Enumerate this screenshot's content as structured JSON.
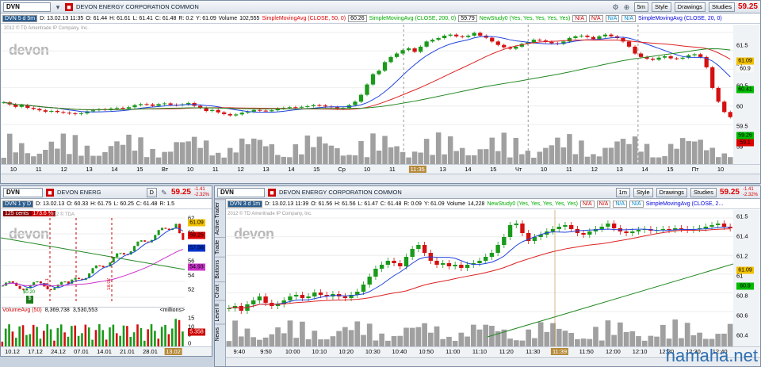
{
  "top": {
    "symbol": "DVN",
    "company": "DEVON ENERGY CORPORATION COMMON",
    "timeframe_label": "DVN 5 d 5m",
    "date": "D: 13.02.13 11:35",
    "open": "O: 61.44",
    "high": "H: 61.61",
    "low": "L: 61.41",
    "close": "C: 61.48",
    "range": "R: 0.2",
    "y": "Y: 61.09",
    "volume_label": "Volume",
    "volume": "102,555",
    "sma50": "SimpleMovingAvg (CLOSE, 50, 0)",
    "sma50_val": "60.26",
    "sma200": "SimpleMovingAvg (CLOSE, 200, 0)",
    "sma200_val": "59.79",
    "study": "NewStudy0 (Yes, Yes, Yes, Yes, Yes)",
    "na": "N/A",
    "sma20": "SimpleMovingAvg (CLOSE, 20, 0)",
    "price": "59.25",
    "aggregation": "5m",
    "style_label": "Style",
    "drawings_label": "Drawings",
    "studies_label": "Studies",
    "copyright": "2012 © TD Ameritrade IP Company, Inc.",
    "watermark": "devon",
    "x_labels": [
      "10",
      "11",
      "12",
      "13",
      "14",
      "15",
      "Вт",
      "10",
      "11",
      "12",
      "13",
      "14",
      "15",
      "Ср",
      "10",
      "11",
      "11:35",
      "13",
      "14",
      "15",
      "Чт",
      "10",
      "11",
      "12",
      "13",
      "14",
      "15",
      "Пт",
      "10"
    ],
    "y_labels": [
      "61.5",
      "61",
      "60.5",
      "60",
      "59.5",
      "59"
    ],
    "y_tags": [
      "61.09",
      "60.9",
      "60.41",
      "59.26",
      "59.1"
    ],
    "candles": [
      59.68,
      59.62,
      59.55,
      59.6,
      59.52,
      59.49,
      59.45,
      59.41,
      59.43,
      59.4,
      59.38,
      59.36,
      59.34,
      59.36,
      59.42,
      59.45,
      59.48,
      59.47,
      59.5,
      59.52,
      59.5,
      59.54,
      59.6,
      59.63,
      59.62,
      59.58,
      59.63,
      59.65,
      59.61,
      59.6,
      59.62,
      59.66,
      59.58,
      59.52,
      59.43,
      59.46,
      59.39,
      59.34,
      59.3,
      59.33,
      59.38,
      59.41,
      59.46,
      59.44,
      59.42,
      59.45,
      59.5,
      59.52,
      59.54,
      59.53,
      59.55,
      59.57,
      59.6,
      59.59,
      59.56,
      59.54,
      59.5,
      59.52,
      59.6,
      59.7,
      59.9,
      60.2,
      60.5,
      60.6,
      60.85,
      61.0,
      61.1,
      61.2,
      61.25,
      61.15,
      61.3,
      61.45,
      61.5,
      61.55,
      61.62,
      61.65,
      61.6,
      61.58,
      61.62,
      61.7,
      61.62,
      61.56,
      61.45,
      61.35,
      61.28,
      61.24,
      61.3,
      61.38,
      61.42,
      61.5,
      61.48,
      61.44,
      61.4,
      61.38,
      61.45,
      61.55,
      61.6,
      61.62,
      61.58,
      61.52,
      61.6,
      61.65,
      61.6,
      61.55,
      61.45,
      61.3,
      61.1,
      61.0,
      60.95,
      60.92,
      60.98,
      61.02,
      60.96,
      60.95,
      60.98,
      61.05,
      61.08,
      61.0,
      60.7,
      60.1,
      59.7,
      59.4,
      59.25
    ]
  },
  "left": {
    "symbol": "DVN",
    "company": "DEVON ENERG",
    "timeframe_label": "DVN 1 y D",
    "date": "D: 13.02.13",
    "open": "O: 60.33",
    "high": "H: 61.75",
    "low": "L: 60.25",
    "close": "C: 61.48",
    "range": "R: 1.5",
    "price": "59.25",
    "change": "-1.41",
    "change_pct": "-2.32%",
    "aggregation": "D",
    "badge_cents": "125 cents",
    "badge_pct": "173.6 %",
    "watermark": "devon",
    "copyright": "2012 © TDA",
    "vol_label": "VolumeAvg (50)",
    "vol1": "8,369,738",
    "vol2": "3,530,553",
    "millions": "<millions>",
    "vol_tag": "5.358",
    "y_labels": [
      "62",
      "60",
      "58",
      "56",
      "54",
      "52"
    ],
    "y_tags": [
      "61.09",
      "59.25",
      "57.56",
      "54.93"
    ],
    "vol_y": [
      "15",
      "10",
      "5",
      "0"
    ],
    "x_labels": [
      "10.12",
      "17.12",
      "24.12",
      "07.01",
      "14.01",
      "21.01",
      "28.01",
      "13.02"
    ],
    "annot1": "21.1",
    "annot2": "18.02",
    "annot3": "$0.20"
  },
  "main": {
    "symbol": "DVN",
    "company": "DEVON ENERGY CORPORATION COMMON",
    "timeframe_label": "DVN 3 d 1m",
    "date": "D: 13.02.13 11:39",
    "open": "O: 61.56",
    "high": "H: 61.56",
    "low": "L: 61.47",
    "close": "C: 61.48",
    "range": "R: 0.09",
    "y": "Y: 61.09",
    "volume_label": "Volume",
    "volume": "14,228",
    "study": "NewStudy0 (Yes, Yes, Yes, Yes, Yes)",
    "na": "N/A",
    "sma": "SimpleMovingAvg (CLOSE, 2...",
    "price": "59.25",
    "change": "-1.41",
    "change_pct": "-2.32%",
    "aggregation": "1m",
    "style_label": "Style",
    "drawings_label": "Drawings",
    "studies_label": "Studies",
    "copyright": "2012 © TD Ameritrade IP Company, Inc.",
    "watermark": "devon",
    "side_tabs": [
      "Active Trader",
      "Trade",
      "Buttons",
      "Chart",
      "Level II",
      "News"
    ],
    "x_labels": [
      "9:40",
      "9:50",
      "10:00",
      "10:10",
      "10:20",
      "10:30",
      "10:40",
      "10:50",
      "11:00",
      "11:10",
      "11:20",
      "11:30",
      "11:39",
      "11:50",
      "12:00",
      "12:10",
      "12:20",
      "12:30",
      "12:40"
    ],
    "y_labels": [
      "61.5",
      "61.4",
      "61.2",
      "61",
      "60.8",
      "60.6",
      "60.4"
    ],
    "y_tags": [
      "61.09",
      "60.9"
    ],
    "candles": [
      60.45,
      60.48,
      60.42,
      60.5,
      60.55,
      60.6,
      60.52,
      60.48,
      60.5,
      60.55,
      60.6,
      60.62,
      60.58,
      60.6,
      60.65,
      60.62,
      60.6,
      60.63,
      60.6,
      60.58,
      60.62,
      60.66,
      60.75,
      60.85,
      60.95,
      61.0,
      61.05,
      61.02,
      60.98,
      61.1,
      61.2,
      61.25,
      61.15,
      61.05,
      61.0,
      61.02,
      60.98,
      61.0,
      60.96,
      61.0,
      61.02,
      61.05,
      61.1,
      61.15,
      61.25,
      61.35,
      61.5,
      61.52,
      61.4,
      61.3,
      61.35,
      61.38,
      61.42,
      61.45,
      61.48,
      61.5,
      61.45,
      61.4,
      61.38,
      61.42,
      61.45,
      61.48,
      61.52,
      61.46,
      61.42,
      61.4,
      61.42,
      61.44,
      61.45,
      61.43,
      61.44,
      61.45,
      61.44,
      61.46,
      61.45,
      61.44,
      61.45,
      61.46,
      61.48,
      61.5,
      61.52,
      61.48,
      61.46
    ]
  },
  "footer": {
    "watermark": "hamaha.net"
  },
  "colors": {
    "up": "#1a9a1a",
    "down": "#d41010",
    "sma20": "#2244dd",
    "sma50": "#dd2222",
    "sma200": "#228822",
    "magenta": "#cc33cc",
    "volume": "#a0a0a0"
  }
}
